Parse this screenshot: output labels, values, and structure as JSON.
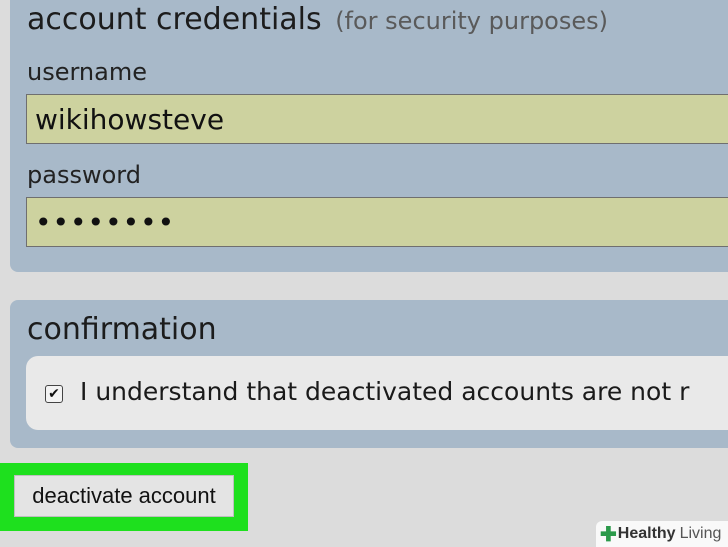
{
  "credentials": {
    "title": "account credentials",
    "subtitle": "(for security purposes)",
    "username_label": "username",
    "username_value": "wikihowsteve",
    "password_label": "password",
    "password_value": "••••••••"
  },
  "confirmation": {
    "title": "confirmation",
    "checkbox_checked": true,
    "checkbox_text": "I understand that deactivated accounts are not r"
  },
  "actions": {
    "deactivate_label": "deactivate account",
    "highlight_color": "#1ee01e"
  },
  "watermark": {
    "brand_bold": "Healthy",
    "brand_light": "Living"
  },
  "colors": {
    "panel": "#a8b9c9",
    "input_bg": "#cdd29f",
    "page_bg": "#dcdcdc"
  }
}
